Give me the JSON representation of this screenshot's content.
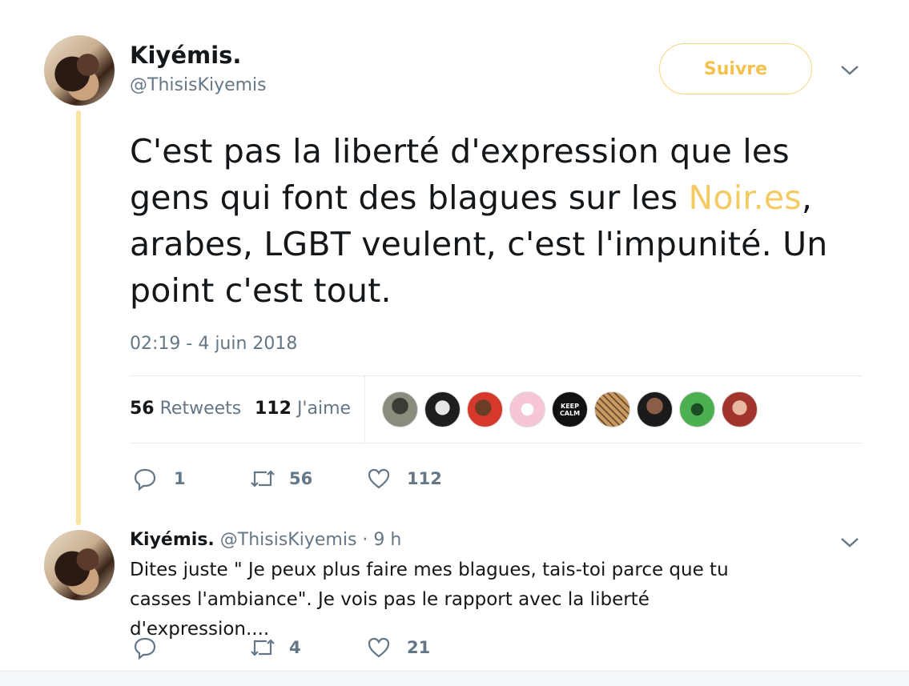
{
  "tweet": {
    "author_name": "Kiyémis.",
    "author_handle": "@ThisisKiyemis",
    "follow_label": "Suivre",
    "text_before": "C'est pas la liberté d'expression que les gens qui font des blagues sur les ",
    "hashtag": "Noir.es",
    "text_after": ", arabes, LGBT veulent, c'est l'impunité. Un point c'est tout.",
    "timestamp": "02:19 - 4 juin 2018",
    "retweets_count": "56",
    "retweets_label": "Retweets",
    "likes_count": "112",
    "likes_label": "J'aime",
    "actions": {
      "reply_count": "1",
      "retweet_count": "56",
      "like_count": "112"
    },
    "likers": [
      {
        "name": "liker-1",
        "color": "#6b6b60"
      },
      {
        "name": "liker-2",
        "color": "#2a2a2a"
      },
      {
        "name": "liker-3",
        "color": "#c0392b"
      },
      {
        "name": "liker-4",
        "color": "#f6c6d8"
      },
      {
        "name": "liker-5",
        "color": "#111111",
        "text": "KEEP CALM"
      },
      {
        "name": "liker-6",
        "color": "#b88a55"
      },
      {
        "name": "liker-7",
        "color": "#7a5a45"
      },
      {
        "name": "liker-8",
        "color": "#2e7d32"
      },
      {
        "name": "liker-9",
        "color": "#a3342c"
      }
    ]
  },
  "reply": {
    "author_name": "Kiyémis.",
    "author_handle": "@ThisisKiyemis",
    "separator": "·",
    "time": "9 h",
    "text": "Dites juste \" Je peux plus faire mes blagues, tais-toi parce que tu casses l'ambiance\". Je vois pas le rapport avec la liberté d'expression....",
    "actions": {
      "reply_count": "",
      "retweet_count": "4",
      "like_count": "21"
    }
  },
  "colors": {
    "accent": "#f4cb63",
    "thread_line": "#fbe3a2",
    "muted": "#657786"
  }
}
